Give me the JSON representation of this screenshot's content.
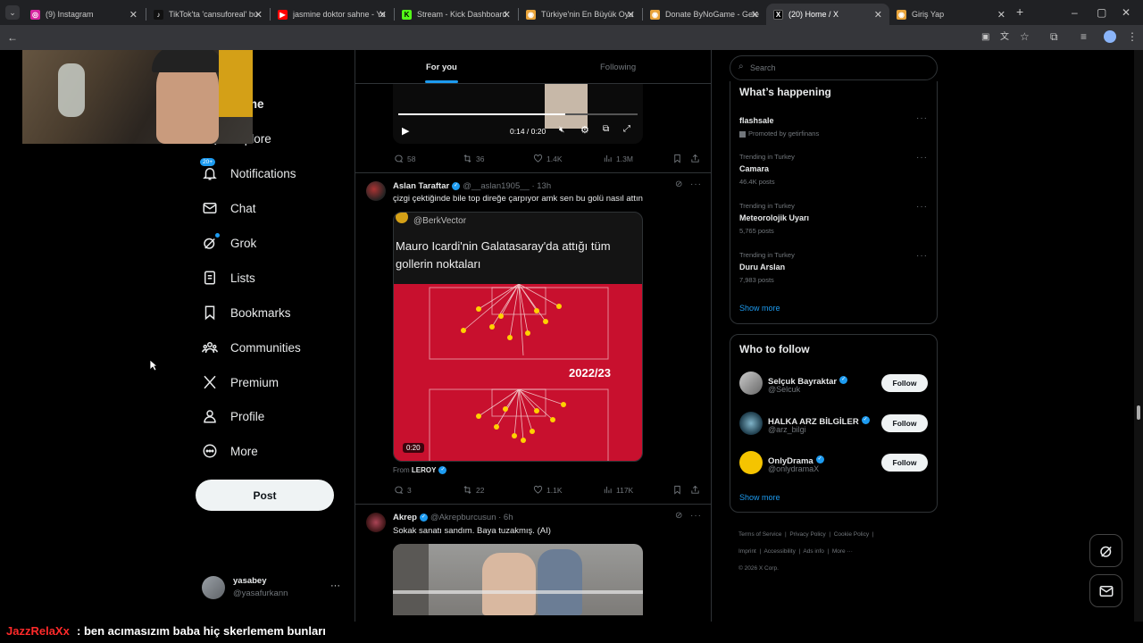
{
  "tabs": [
    {
      "label": "(9) Instagram",
      "fav_color": "#d6249f",
      "fav_glyph": "◎"
    },
    {
      "label": "TikTok'ta 'cansuforeal' bu",
      "fav_color": "#111111",
      "fav_glyph": "♪"
    },
    {
      "label": "jasmine doktor sahne - Yo",
      "fav_color": "#ff0000",
      "fav_glyph": "▶"
    },
    {
      "label": "Stream - Kick Dashboard",
      "fav_color": "#53fc18",
      "fav_glyph": "K"
    },
    {
      "label": "Türkiye'nin En Büyük Oyu",
      "fav_color": "#e8a33a",
      "fav_glyph": "◉"
    },
    {
      "label": "Donate ByNoGame - Gele",
      "fav_color": "#e8a33a",
      "fav_glyph": "◉"
    },
    {
      "label": "(20) Home / X",
      "fav_color": "#000000",
      "fav_glyph": "X"
    },
    {
      "label": "Giriş Yap",
      "fav_color": "#e8a33a",
      "fav_glyph": "◉"
    }
  ],
  "new_tab_glyph": "+",
  "window_controls": {
    "minimize": "–",
    "maximize": "▢",
    "close": "✕"
  },
  "feed_tabs": {
    "for_you": "For you",
    "following": "Following"
  },
  "nav": {
    "home": "Home",
    "explore": "Explore",
    "notifications": "Notifications",
    "notifications_badge": "20+",
    "chat": "Chat",
    "grok": "Grok",
    "lists": "Lists",
    "bookmarks": "Bookmarks",
    "communities": "Communities",
    "premium": "Premium",
    "profile": "Profile",
    "more": "More",
    "post_button": "Post"
  },
  "account": {
    "name": "yasabey",
    "handle": "@yasafurkann",
    "menu": "···"
  },
  "video_player": {
    "time": "0:14 / 0:20"
  },
  "tweet0_actions": {
    "replies": "58",
    "reposts": "36",
    "likes": "1.4K",
    "views": "1.3M"
  },
  "tweet1": {
    "name": "Aslan Taraftar",
    "handle": "@__aslan1905__",
    "time": "· 13h",
    "text": "çizgi çektiğinde bile top direğe çarpıyor amk sen bu golü nasıl attın",
    "media_handle": "@BerkVector",
    "media_title": "Mauro Icardi'nin Galatasaray'da attığı tüm gollerin noktaları",
    "media_season": "2022/23",
    "media_duration": "0:20",
    "from_label": "From",
    "from_name": "LEROY",
    "replies": "3",
    "reposts": "22",
    "likes": "1.1K",
    "views": "117K"
  },
  "tweet2": {
    "name": "Akrep",
    "handle": "@Akrepburcusun",
    "time": "· 6h",
    "text": "Sokak sanatı sandım. Baya tuzakmış. (AI)"
  },
  "search": {
    "placeholder": "Search"
  },
  "whats_happening": {
    "title": "What’s happening",
    "trends": [
      {
        "meta": "Promoted by getirfinans",
        "name": "flashsale",
        "posts": ""
      },
      {
        "meta": "Trending in Turkey",
        "name": "Camara",
        "posts": "46.4K posts"
      },
      {
        "meta": "Trending in Turkey",
        "name": "Meteorolojik Uyarı",
        "posts": "5,765 posts"
      },
      {
        "meta": "Trending in Turkey",
        "name": "Duru Arslan",
        "posts": "7,983 posts"
      }
    ],
    "show_more": "Show more"
  },
  "who_to_follow": {
    "title": "Who to follow",
    "users": [
      {
        "name": "Selçuk Bayraktar",
        "handle": "@Selcuk",
        "button": "Follow"
      },
      {
        "name": "HALKA ARZ BİLGİLER",
        "handle": "@arz_bilgi",
        "button": "Follow"
      },
      {
        "name": "OnlyDrama",
        "handle": "@onlydramaX",
        "button": "Follow"
      }
    ],
    "show_more": "Show more"
  },
  "footer": {
    "links": [
      "Terms of Service",
      "Privacy Policy",
      "Cookie Policy",
      "Imprint",
      "Accessibility",
      "Ads info",
      "More ···"
    ],
    "copyright": "© 2026 X Corp."
  },
  "chat_overlay": {
    "user": "JazzRelaXx",
    "message": ": ben acımasızım baba hiç skerlemem bunları"
  },
  "colors": {
    "accent": "#1d9bf0",
    "chat_user": "#ff2a2a"
  }
}
